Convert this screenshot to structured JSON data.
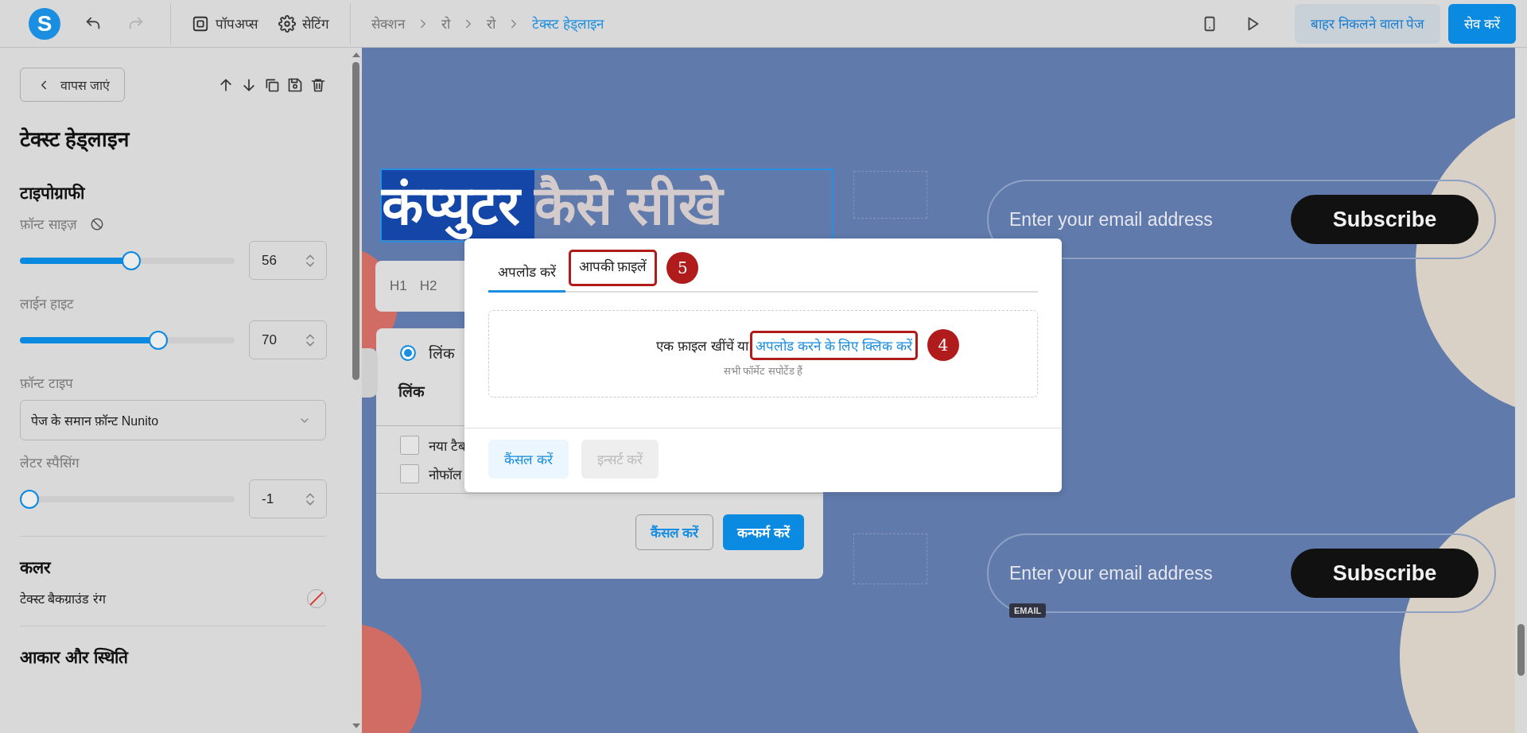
{
  "toolbar": {
    "logo": "S",
    "undo": {
      "disabled": false
    },
    "redo": {
      "disabled": true
    },
    "nav": [
      {
        "kind": "popups",
        "label": "पॉपअप्स"
      },
      {
        "kind": "settings",
        "label": "सेटिंग"
      }
    ],
    "breadcrumb": [
      {
        "label": "सेक्शन",
        "current": false
      },
      {
        "label": "रो",
        "current": false
      },
      {
        "label": "रो",
        "current": false
      },
      {
        "label": "टेक्स्ट हेड्लाइन",
        "current": true
      }
    ],
    "exit_button": "बाहर निकलने वाला पेज",
    "save_button": "सेव करें"
  },
  "sidebar": {
    "back_button": "वापस जाएं",
    "title": "टेक्स्ट हेड्लाइन",
    "sections": [
      {
        "heading": "टाइपोग्राफी",
        "controls": [
          {
            "kind": "slider",
            "label": "फ़ॉन्ट साइज़",
            "reset": true,
            "level": 0.52,
            "value": "56"
          },
          {
            "kind": "slider",
            "label": "लाईन हाइट",
            "reset": false,
            "level": 0.66,
            "value": "70"
          },
          {
            "kind": "select",
            "label": "फ़ॉन्ट टाइप",
            "value": "पेज के समान फ़ॉन्ट Nunito"
          },
          {
            "kind": "slider",
            "label": "लेटर स्पैसिंग",
            "reset": false,
            "level": 0,
            "value": "-1"
          }
        ]
      },
      {
        "heading": "कलर",
        "controls": [
          {
            "kind": "color",
            "label": "टेक्स्ट बैकग्राउंड रंग"
          }
        ]
      },
      {
        "heading": "आकार और स्थिति"
      }
    ]
  },
  "canvas": {
    "headline": [
      {
        "text": "कंप्युटर",
        "selected": true
      },
      {
        "text": "कैसे सीखे",
        "selected": false
      }
    ],
    "forms": [
      {
        "placeholder": "Enter your email address",
        "button": "Subscribe"
      },
      {
        "placeholder": "Enter your email address",
        "button": "Subscribe",
        "tag": "EMAIL"
      }
    ],
    "format_toolbar": [
      "H1",
      "H2"
    ],
    "link_panel": {
      "radio": {
        "label": "लिंक",
        "selected": true
      },
      "field_label": "लिंक",
      "checkboxes": [
        {
          "label": "नया टैब",
          "checked": false
        },
        {
          "label": "नोफॉल",
          "checked": false
        }
      ],
      "cancel": "कैंसल करें",
      "confirm": "कन्फर्म करें"
    },
    "upload_dialog": {
      "tabs": [
        {
          "label": "अपलोड करें",
          "selected": true
        },
        {
          "label": "आपकी फ़ाइलें",
          "selected": false,
          "annotation": "5"
        }
      ],
      "drop_text": "एक फ़ाइल खींचें या",
      "drop_link": "अपलोड करने के लिए क्लिक करें",
      "drop_link_annotation": "4",
      "hint": "सभी फॉर्मेट सपोर्टेड हैं",
      "buttons": [
        {
          "label": "कैंसल करें",
          "disabled": false
        },
        {
          "label": "इन्सर्ट करें",
          "disabled": true
        }
      ]
    }
  }
}
